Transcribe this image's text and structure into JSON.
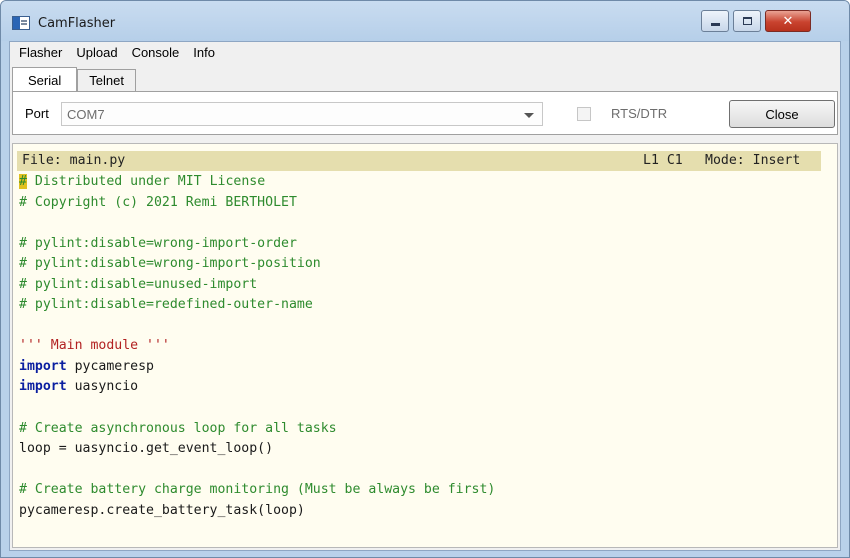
{
  "window": {
    "title": "CamFlasher",
    "controls": {
      "minimize": "",
      "maximize": "",
      "close": "✕"
    }
  },
  "menu": [
    "Flasher",
    "Upload",
    "Console",
    "Info"
  ],
  "tabs": [
    {
      "label": "Serial",
      "active": true
    },
    {
      "label": "Telnet",
      "active": false
    }
  ],
  "serial": {
    "port_label": "Port",
    "port_value": "COM7",
    "rts_label": "RTS/DTR",
    "rts_checked": false,
    "close_label": "Close"
  },
  "editor": {
    "status": {
      "file": "File: main.py",
      "position": "L1 C1",
      "mode": "Mode: Insert"
    },
    "lines": [
      [
        [
          "cursor",
          "#"
        ],
        [
          "comment",
          " Distributed under MIT License"
        ]
      ],
      [
        [
          "comment",
          "# Copyright (c) 2021 Remi BERTHOLET"
        ]
      ],
      [],
      [
        [
          "comment",
          "# pylint:disable=wrong-import-order"
        ]
      ],
      [
        [
          "comment",
          "# pylint:disable=wrong-import-position"
        ]
      ],
      [
        [
          "comment",
          "# pylint:disable=unused-import"
        ]
      ],
      [
        [
          "comment",
          "# pylint:disable=redefined-outer-name"
        ]
      ],
      [],
      [
        [
          "string",
          "''' Main module '''"
        ]
      ],
      [
        [
          "keyword",
          "import"
        ],
        [
          "plain",
          " pycameresp"
        ]
      ],
      [
        [
          "keyword",
          "import"
        ],
        [
          "plain",
          " uasyncio"
        ]
      ],
      [],
      [
        [
          "comment",
          "# Create asynchronous loop for all tasks"
        ]
      ],
      [
        [
          "plain",
          "loop = uasyncio.get_event_loop()"
        ]
      ],
      [],
      [
        [
          "comment",
          "# Create battery charge monitoring (Must be always be first)"
        ]
      ],
      [
        [
          "plain",
          "pycameresp.create_battery_task(loop)"
        ]
      ]
    ]
  }
}
